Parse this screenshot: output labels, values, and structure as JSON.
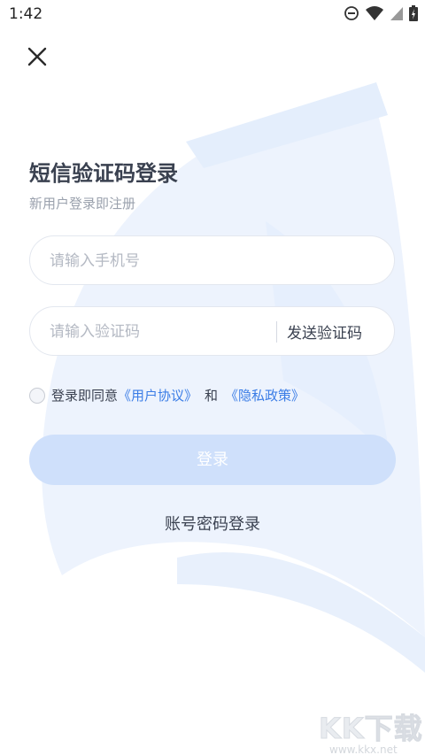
{
  "status_bar": {
    "time": "1:42"
  },
  "header": {
    "title": "短信验证码登录",
    "subtitle": "新用户登录即注册"
  },
  "phone_input": {
    "placeholder": "请输入手机号"
  },
  "code_input": {
    "placeholder": "请输入验证码",
    "send_label": "发送验证码"
  },
  "agreement": {
    "prefix": "登录即同意",
    "user_agreement": "《用户协议》",
    "and": "和",
    "privacy_policy": "《隐私政策》"
  },
  "login_button": {
    "label": "登录"
  },
  "alt_login": {
    "label": "账号密码登录"
  },
  "watermark": {
    "main": "KK下载",
    "sub": "www.kkx.net"
  },
  "colors": {
    "accent": "#3b7de6",
    "button_disabled": "#cfe0fb",
    "title": "#3a4150",
    "background_art": "#eaf2fd"
  }
}
